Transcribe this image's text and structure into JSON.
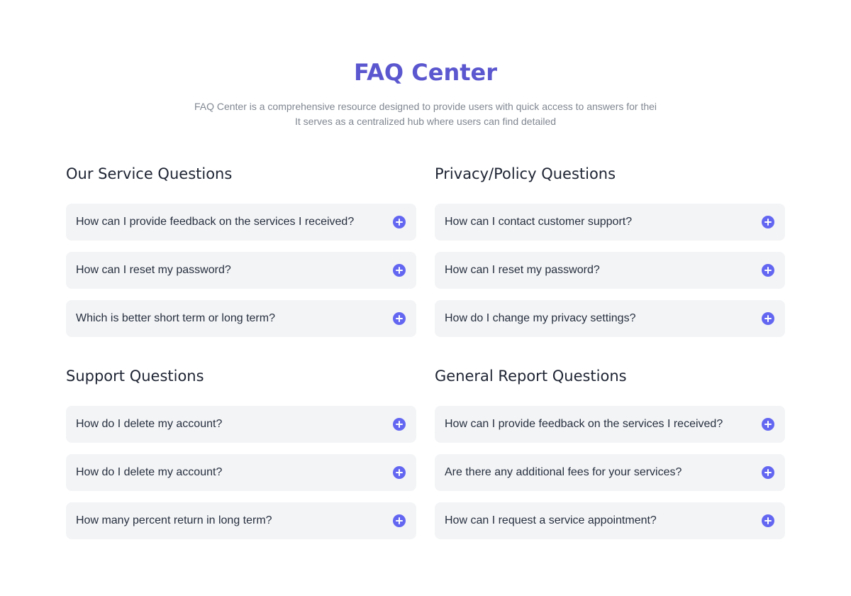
{
  "header": {
    "title": "FAQ Center",
    "subtitle_line1": "FAQ Center is a comprehensive resource designed to provide users with quick access to answers for thei",
    "subtitle_line2": "It serves as a centralized hub where users can find detailed"
  },
  "colors": {
    "accent": "#5b57cf",
    "icon": "#6366f1",
    "card_bg": "#f3f4f6"
  },
  "sections": [
    {
      "title": "Our Service Questions",
      "items": [
        {
          "question": "How can I provide feedback on the services I received?",
          "icon": "plus-circle-icon"
        },
        {
          "question": "How can I reset my password?",
          "icon": "plus-circle-icon"
        },
        {
          "question": "Which is better short term or long term?",
          "icon": "plus-circle-icon"
        }
      ]
    },
    {
      "title": "Privacy/Policy Questions",
      "items": [
        {
          "question": "How can I contact customer support?",
          "icon": "plus-circle-icon"
        },
        {
          "question": "How can I reset my password?",
          "icon": "plus-circle-icon"
        },
        {
          "question": "How do I change my privacy settings?",
          "icon": "plus-circle-icon"
        }
      ]
    },
    {
      "title": "Support Questions",
      "items": [
        {
          "question": "How do I delete my account?",
          "icon": "plus-circle-icon"
        },
        {
          "question": "How do I delete my account?",
          "icon": "plus-circle-icon"
        },
        {
          "question": "How many percent return in long term?",
          "icon": "plus-circle-icon"
        }
      ]
    },
    {
      "title": "General Report Questions",
      "items": [
        {
          "question": "How can I provide feedback on the services I received?",
          "icon": "plus-circle-icon"
        },
        {
          "question": "Are there any additional fees for your services?",
          "icon": "plus-circle-icon"
        },
        {
          "question": "How can I request a service appointment?",
          "icon": "plus-circle-icon"
        }
      ]
    }
  ]
}
